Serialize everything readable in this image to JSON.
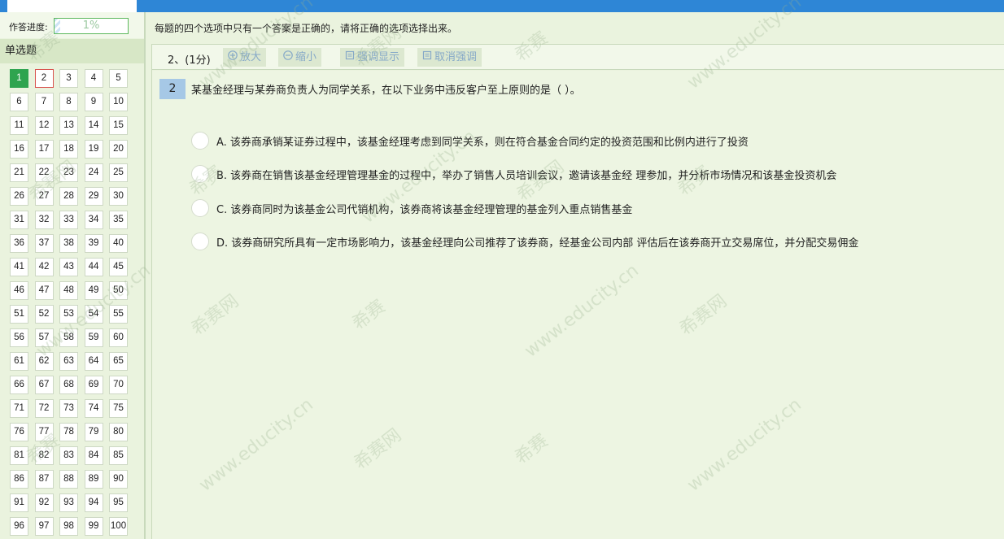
{
  "sidebar": {
    "progress_label": "作答进度:",
    "progress_percent": 1,
    "progress_text": "1%",
    "section_title": "单选题",
    "questions": [
      "1",
      "2",
      "3",
      "4",
      "5",
      "6",
      "7",
      "8",
      "9",
      "10",
      "11",
      "12",
      "13",
      "14",
      "15",
      "16",
      "17",
      "18",
      "19",
      "20",
      "21",
      "22",
      "23",
      "24",
      "25",
      "26",
      "27",
      "28",
      "29",
      "30",
      "31",
      "32",
      "33",
      "34",
      "35",
      "36",
      "37",
      "38",
      "39",
      "40",
      "41",
      "42",
      "43",
      "44",
      "45",
      "46",
      "47",
      "48",
      "49",
      "50",
      "51",
      "52",
      "53",
      "54",
      "55",
      "56",
      "57",
      "58",
      "59",
      "60",
      "61",
      "62",
      "63",
      "64",
      "65",
      "66",
      "67",
      "68",
      "69",
      "70",
      "71",
      "72",
      "73",
      "74",
      "75",
      "76",
      "77",
      "78",
      "79",
      "80",
      "81",
      "82",
      "83",
      "84",
      "85",
      "86",
      "87",
      "88",
      "89",
      "90",
      "91",
      "92",
      "93",
      "94",
      "95",
      "96",
      "97",
      "98",
      "99",
      "100"
    ],
    "answered": [
      "1"
    ],
    "current": "2"
  },
  "main": {
    "instructions": "每题的四个选项中只有一个答案是正确的，请将正确的选项选择出来。",
    "question_score": "2、(1分)",
    "toolbar": {
      "zoom_in": "放大",
      "zoom_out": "缩小",
      "highlight": "强调显示",
      "cancel_highlight": "取消强调"
    },
    "question_number": "2",
    "question_stem": "某基金经理与某券商负责人为同学关系，在以下业务中违反客户至上原则的是（ ）。",
    "options": [
      {
        "label": "A. 该券商承销某证券过程中，该基金经理考虑到同学关系，则在符合基金合同约定的投资范围和比例内进行了投资"
      },
      {
        "label": "B. 该券商在销售该基金经理管理基金的过程中，举办了销售人员培训会议，邀请该基金经 理参加，并分析市场情况和该基金投资机会"
      },
      {
        "label": "C. 该券商同时为该基金公司代销机构，该券商将该基金经理管理的基金列入重点销售基金"
      },
      {
        "label": "D. 该券商研究所具有一定市场影响力，该基金经理向公司推荐了该券商，经基金公司内部 评估后在该券商开立交易席位，并分配交易佣金"
      }
    ]
  },
  "watermark": {
    "brand": "希赛",
    "brand_site": "希赛网",
    "url": "www.educity.cn"
  },
  "colors": {
    "accent": "#2e86d6",
    "answered": "#2ea44f",
    "current_border": "#d9534f",
    "number_badge": "#a6c8e6"
  }
}
